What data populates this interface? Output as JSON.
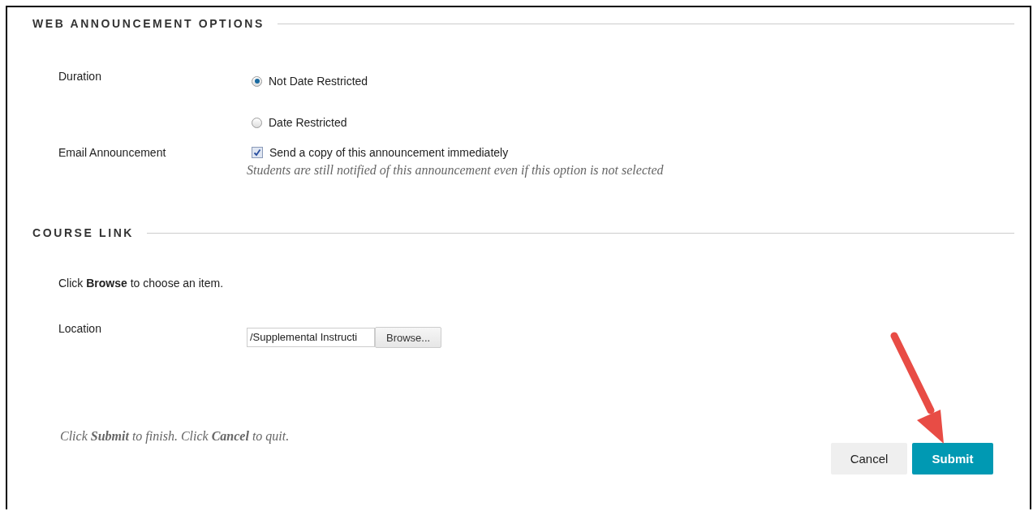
{
  "sections": [
    {
      "title": "WEB ANNOUNCEMENT OPTIONS",
      "rows": [
        {
          "kind": "radio",
          "label": "Duration",
          "options": [
            {
              "label": "Not Date Restricted",
              "selected": true
            },
            {
              "label": "Date Restricted",
              "selected": false
            }
          ]
        },
        {
          "kind": "checkbox",
          "label": "Email Announcement",
          "option": {
            "label": "Send a copy of this announcement immediately",
            "checked": true
          },
          "note": "Students are still notified of this announcement even if this option is not selected"
        }
      ]
    },
    {
      "title": "COURSE LINK",
      "instruction": "Click **Browse** to choose an item.",
      "rows": [
        {
          "kind": "file",
          "label": "Location",
          "value": "/Supplemental Instructi",
          "button": "Browse..."
        }
      ]
    }
  ],
  "footer": {
    "note": "Click **Submit** to finish. Click **Cancel** to quit."
  },
  "buttons": [
    {
      "label": "Cancel",
      "kind": "secondary"
    },
    {
      "label": "Submit",
      "kind": "primary"
    }
  ],
  "annotation_arrow": true
}
